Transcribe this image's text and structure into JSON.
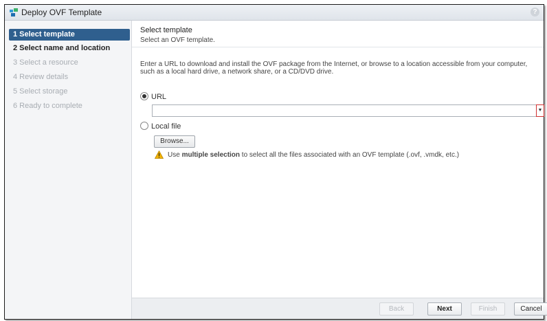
{
  "window": {
    "title": "Deploy OVF Template",
    "help_glyph": "?"
  },
  "steps": [
    {
      "label": "1  Select template",
      "state": "active"
    },
    {
      "label": "2  Select name and location",
      "state": "done"
    },
    {
      "label": "3  Select a resource",
      "state": "disabled"
    },
    {
      "label": "4  Review details",
      "state": "disabled"
    },
    {
      "label": "5  Select storage",
      "state": "disabled"
    },
    {
      "label": "6  Ready to complete",
      "state": "disabled"
    }
  ],
  "content": {
    "title": "Select template",
    "subtitle": "Select an OVF template.",
    "description": "Enter a URL to download and install the OVF package from the Internet, or browse to a location accessible from your computer, such as a local hard drive, a network share, or a CD/DVD drive.",
    "url_label": "URL",
    "url_value": "",
    "url_selected": true,
    "local_file_label": "Local file",
    "browse_label": "Browse...",
    "warning_prefix": "Use ",
    "warning_bold": "multiple selection",
    "warning_suffix": " to select all the files associated with an OVF template (.ovf, .vmdk, etc.)"
  },
  "footer": {
    "back_label": "Back",
    "next_label": "Next",
    "finish_label": "Finish",
    "cancel_label": "Cancel"
  },
  "icons": {
    "title": "vm-template-icon",
    "warning": "warning-icon",
    "dropdown": "chevron-down-icon"
  },
  "colors": {
    "active_step": "#2f5f8e",
    "warning": "#f2b300",
    "error_border": "#d03030"
  }
}
